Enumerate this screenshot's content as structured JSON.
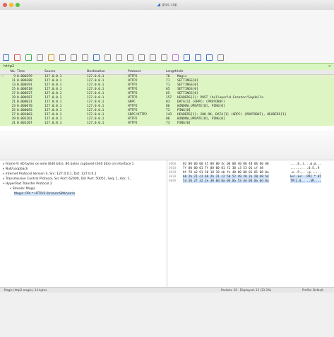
{
  "window": {
    "title": "grpc.cap"
  },
  "colors": {
    "selected_row": "#e1f2c7",
    "row_green": "#ddf4c3",
    "filter_ok": "#d8f7c0"
  },
  "toolbar": {
    "icons": [
      "shark-fin-icon",
      "stop-icon",
      "restart-icon",
      "options-icon",
      "open-icon",
      "save-icon",
      "close-icon",
      "reload-icon",
      "find-icon",
      "back-icon",
      "forward-icon",
      "goto-icon",
      "first-icon",
      "last-icon",
      "autoscroll-icon",
      "colorize-icon",
      "zoom-in-icon",
      "zoom-out-icon",
      "zoom-reset-icon",
      "resize-columns-icon"
    ]
  },
  "filter": {
    "value": "http2",
    "clear": "×"
  },
  "packet_list": {
    "columns": [
      "No.",
      "Time",
      "Source",
      "Destination",
      "Protocol",
      "Length",
      "Info"
    ],
    "rows": [
      {
        "no": "9",
        "time": "0.000359",
        "src": "127.0.0.1",
        "dst": "127.0.0.1",
        "proto": "HTTP2",
        "len": "78",
        "info": "Magic"
      },
      {
        "no": "11",
        "time": "0.000388",
        "src": "127.0.0.1",
        "dst": "127.0.0.1",
        "proto": "HTTP2",
        "len": "71",
        "info": "SETTINGS[0]"
      },
      {
        "no": "13",
        "time": "0.000391",
        "src": "127.0.0.1",
        "dst": "127.0.0.1",
        "proto": "HTTP2",
        "len": "71",
        "info": "SETTINGS[0]"
      },
      {
        "no": "15",
        "time": "0.000518",
        "src": "127.0.0.1",
        "dst": "127.0.0.1",
        "proto": "HTTP2",
        "len": "65",
        "info": "SETTINGS[0]"
      },
      {
        "no": "17",
        "time": "0.000527",
        "src": "127.0.0.1",
        "dst": "127.0.0.1",
        "proto": "HTTP2",
        "len": "65",
        "info": "SETTINGS[0]"
      },
      {
        "no": "19",
        "time": "0.000587",
        "src": "127.0.0.1",
        "dst": "127.0.0.1",
        "proto": "HTTP2",
        "len": "157",
        "info": "HEADERS[1]: POST /helloworld.Greeter/SayHello"
      },
      {
        "no": "21",
        "time": "0.000631",
        "src": "127.0.0.1",
        "dst": "127.0.0.1",
        "proto": "GRPC",
        "len": "83",
        "info": "DATA[1] (GRPC) (PROTOBUF)"
      },
      {
        "no": "23",
        "time": "0.000670",
        "src": "127.0.0.1",
        "dst": "127.0.0.1",
        "proto": "HTTP2",
        "len": "86",
        "info": "WINDOW_UPDATE[0], PING[0]"
      },
      {
        "no": "25",
        "time": "0.000683",
        "src": "127.0.0.1",
        "dst": "127.0.0.1",
        "proto": "HTTP2",
        "len": "73",
        "info": "PING[0]"
      },
      {
        "no": "27",
        "time": "0.001003",
        "src": "127.0.0.1",
        "dst": "127.0.0.1",
        "proto": "GRPC/HTTP2",
        "len": "143",
        "info": "HEADERS[1]: 200 OK, DATA[1] (GRPC) (PROTOBUF), HEADERS[1]"
      },
      {
        "no": "29",
        "time": "0.001201",
        "src": "127.0.0.1",
        "dst": "127.0.0.1",
        "proto": "HTTP2",
        "len": "86",
        "info": "WINDOW_UPDATE[0], PING[0]"
      },
      {
        "no": "31",
        "time": "0.001207",
        "src": "127.0.0.1",
        "dst": "127.0.0.1",
        "proto": "HTTP2",
        "len": "73",
        "info": "PING[0]"
      }
    ]
  },
  "details": {
    "lines": [
      "Frame 9: 80 bytes on wire (640 bits), 80 bytes captured (640 bits) on interface 1",
      "Null/Loopback",
      "Internet Protocol Version 4, Src: 127.0.0.1, Dst: 127.0.0.1",
      "Transmission Control Protocol, Src Port: 62000, Dst Port: 50051, Seq: 1, Ack: 1,",
      "HyperText Transfer Protocol 2",
      "Stream: Magic",
      "Magic: PRI * HTTP/2.0\\r\\n\\r\\nSM\\r\\n\\r\\n"
    ]
  },
  "hex": {
    "rows": [
      {
        "off": "0000",
        "bytes": "02 00 00 00 45 00 00 4c  00 00 40 00 40 06 00 00",
        "ascii": "....E..L ..@.@..."
      },
      {
        "off": "0010",
        "bytes": "7f 00 00 01 7f 00 00 01  f2 30 c3 53 01 cf 48",
        "ascii": "........ .0.S..H"
      },
      {
        "off": "0020",
        "bytes": "8f 78 a2 91 50 18 18 eb  fe 40 00 00 01 01 08 0a",
        "ascii": ".x..P... .@......"
      },
      {
        "off": "0030",
        "bytes": "6b 2b 21 c2 6b 2b 21 c2  50 52 49 20 2a 20 48 54",
        "ascii": "k+!.k+!. PRI * HT"
      },
      {
        "off": "0040",
        "bytes": "54 50 2f 32 2e 30 0d 0a  0d 0a 53 4d 0d 0a 0d 0a",
        "ascii": "TP/2.0.. ..SM...."
      }
    ]
  },
  "status": {
    "left": "Magic (http2.magic), 24 bytes",
    "middle": "Packets: 36 · Displayed: 12 (33.3%)",
    "right": "Profile: Default"
  }
}
